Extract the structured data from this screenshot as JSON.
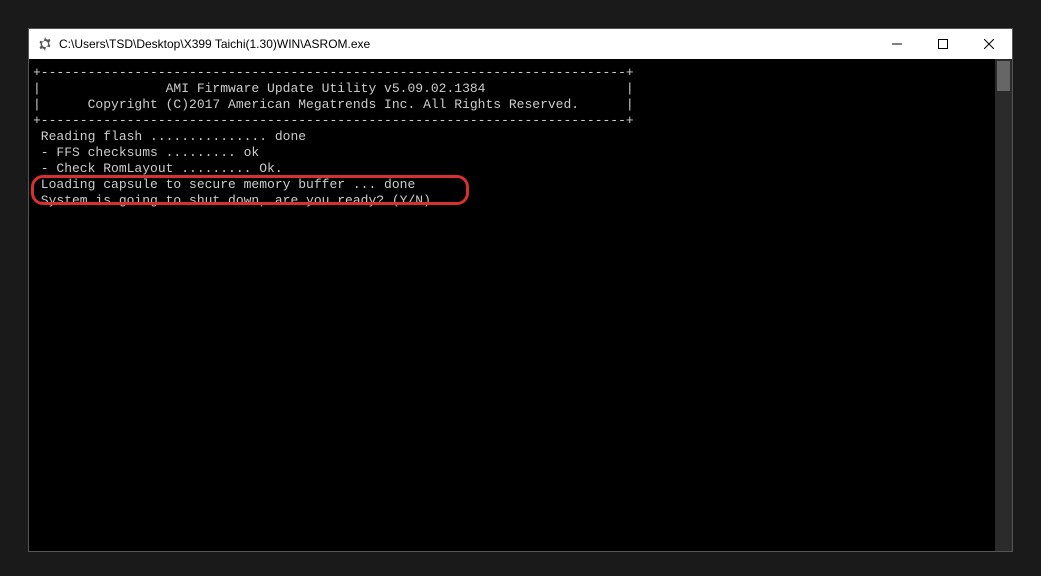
{
  "window": {
    "title": "C:\\Users\\TSD\\Desktop\\X399 Taichi(1.30)WIN\\ASROM.exe"
  },
  "console": {
    "border_top": "+---------------------------------------------------------------------------+",
    "header_line1": "|                AMI Firmware Update Utility v5.09.02.1384                  |",
    "header_line2": "|      Copyright (C)2017 American Megatrends Inc. All Rights Reserved.      |",
    "border_bottom": "+---------------------------------------------------------------------------+",
    "line_reading": " Reading flash ............... done",
    "line_ffs": " - FFS checksums ......... ok",
    "line_romlayout": " - Check RomLayout ......... Ok.",
    "line_loading": " Loading capsule to secure memory buffer ... done",
    "line_prompt": " System is going to shut down, are you ready? (Y/N)..."
  }
}
